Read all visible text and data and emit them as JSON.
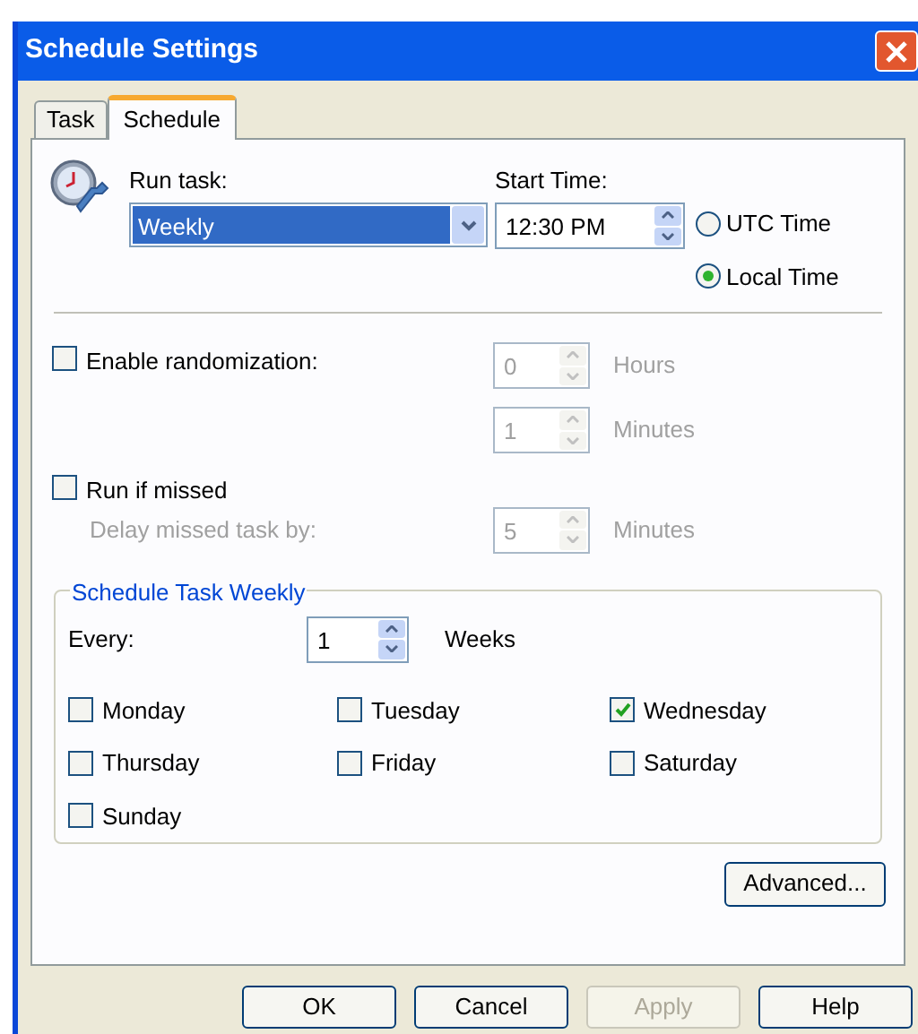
{
  "window": {
    "title": "Schedule Settings"
  },
  "tabs": [
    {
      "label": "Task",
      "selected": false
    },
    {
      "label": "Schedule",
      "selected": true
    }
  ],
  "run_task": {
    "label": "Run task:",
    "value": "Weekly"
  },
  "start_time": {
    "label": "Start Time:",
    "value": "12:30 PM"
  },
  "time_zone": [
    {
      "label": "UTC Time",
      "selected": false
    },
    {
      "label": "Local Time",
      "selected": true
    }
  ],
  "randomization": {
    "label": "Enable randomization:",
    "checked": false,
    "fields": [
      {
        "value": "0",
        "unit": "Hours",
        "disabled": true
      },
      {
        "value": "1",
        "unit": "Minutes",
        "disabled": true
      }
    ]
  },
  "run_if_missed": {
    "label": "Run if missed",
    "checked": false,
    "delay_label": "Delay missed task by:",
    "value": "5",
    "unit": "Minutes",
    "disabled": true
  },
  "weekly": {
    "title": "Schedule Task Weekly",
    "every_label": "Every:",
    "value": "1",
    "unit": "Weeks",
    "days": [
      {
        "label": "Monday",
        "checked": false
      },
      {
        "label": "Tuesday",
        "checked": false
      },
      {
        "label": "Wednesday",
        "checked": true
      },
      {
        "label": "Thursday",
        "checked": false
      },
      {
        "label": "Friday",
        "checked": false
      },
      {
        "label": "Saturday",
        "checked": false
      },
      {
        "label": "Sunday",
        "checked": false
      }
    ]
  },
  "advanced_button": "Advanced...",
  "buttons": [
    {
      "label": "OK",
      "disabled": false
    },
    {
      "label": "Cancel",
      "disabled": false
    },
    {
      "label": "Apply",
      "disabled": true
    },
    {
      "label": "Help",
      "disabled": false
    }
  ]
}
